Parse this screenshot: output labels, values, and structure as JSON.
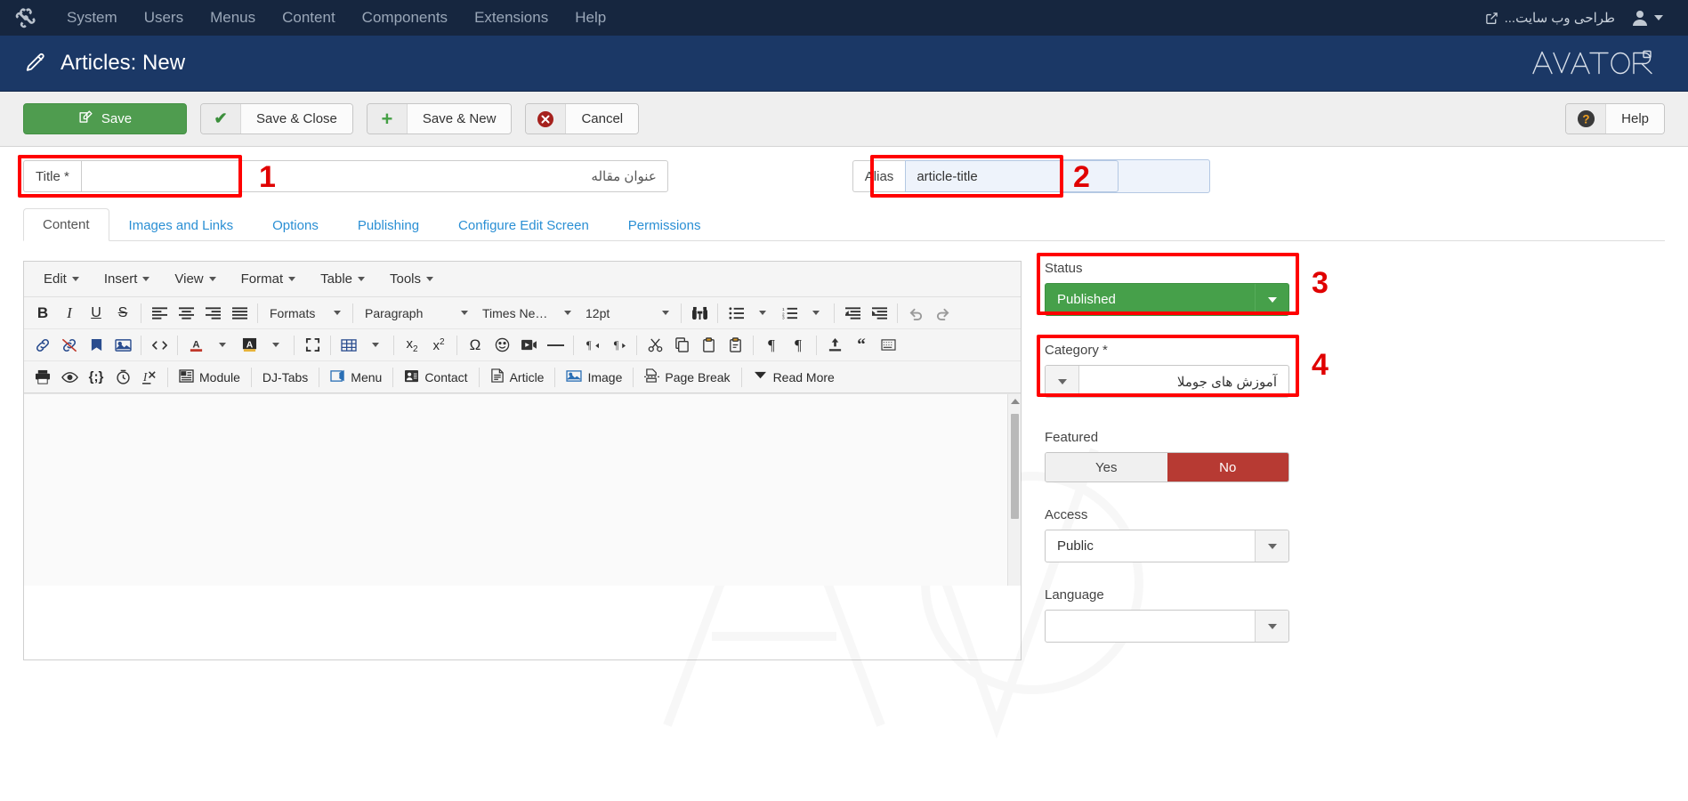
{
  "topnav": {
    "logo_icon": "joomla-logo-icon",
    "items": [
      "System",
      "Users",
      "Menus",
      "Content",
      "Components",
      "Extensions",
      "Help"
    ],
    "site_name": "طراحی وب سایت...",
    "external_link_icon": "external-link-icon",
    "user_icon": "user-avatar-icon"
  },
  "header": {
    "icon": "pencil-icon",
    "title": "Articles: New",
    "brand_logo": "AVATAR"
  },
  "toolbar": {
    "save_label": "Save",
    "save_icon": "save-pencil-icon",
    "save_close_label": "Save & Close",
    "save_close_icon": "check-icon",
    "save_new_label": "Save & New",
    "save_new_icon": "plus-icon",
    "cancel_label": "Cancel",
    "cancel_icon": "cancel-circle-icon",
    "help_label": "Help",
    "help_icon": "question-circle-icon"
  },
  "form": {
    "title_label": "Title *",
    "title_value": "عنوان مقاله",
    "alias_label": "Alias",
    "alias_value": "article-title",
    "annotations": [
      "1",
      "2",
      "3",
      "4"
    ]
  },
  "tabs": [
    {
      "label": "Content",
      "active": true
    },
    {
      "label": "Images and Links",
      "active": false
    },
    {
      "label": "Options",
      "active": false
    },
    {
      "label": "Publishing",
      "active": false
    },
    {
      "label": "Configure Edit Screen",
      "active": false
    },
    {
      "label": "Permissions",
      "active": false
    }
  ],
  "editor": {
    "menubar": [
      "Edit",
      "Insert",
      "View",
      "Format",
      "Table",
      "Tools"
    ],
    "row1": {
      "bold": "B",
      "italic": "I",
      "underline": "U",
      "strike": "S",
      "align_left": "align-left-icon",
      "align_center": "align-center-icon",
      "align_right": "align-right-icon",
      "align_justify": "align-justify-icon",
      "formats_label": "Formats",
      "paragraph_label": "Paragraph",
      "font_label": "Times Ne…",
      "fontsize_label": "12pt",
      "searchreplace": "binoculars-icon",
      "bullist": "bullet-list-icon",
      "numlist": "numbered-list-icon",
      "outdent": "outdent-icon",
      "indent": "indent-icon",
      "undo": "undo-icon",
      "redo": "redo-icon"
    },
    "row2": {
      "link": "link-icon",
      "unlink": "unlink-icon",
      "anchor": "anchor-icon",
      "image": "image-icon",
      "code": "source-code-icon",
      "forecolor": "text-color-icon",
      "backcolor": "highlight-color-icon",
      "fullscreen": "fullscreen-icon",
      "table": "table-icon",
      "subscript": "subscript-icon",
      "superscript": "superscript-icon",
      "charmap": "omega-special-char-icon",
      "emoticons": "emoticon-icon",
      "media": "media-icon",
      "hr": "horizontal-rule-icon",
      "ltr": "ltr-direction-icon",
      "rtl": "rtl-direction-icon",
      "cut": "cut-scissors-icon",
      "copy": "copy-icon",
      "paste": "paste-icon",
      "pastetext": "paste-text-icon",
      "visualchars": "pilcrow-icon",
      "visualblocks": "paragraph-blocks-icon",
      "template": "upload-template-icon",
      "blockquote": "blockquote-icon",
      "nonbreaking": "nonbreaking-space-icon"
    },
    "row3": [
      {
        "icon": "print-icon",
        "label": ""
      },
      {
        "icon": "preview-icon",
        "label": ""
      },
      {
        "icon": "code-braces-icon",
        "label": ""
      },
      {
        "icon": "insertdatetime-icon",
        "label": ""
      },
      {
        "icon": "remove-format-icon",
        "label": ""
      },
      {
        "icon": "module-icon",
        "label": "Module"
      },
      {
        "icon": "djtabs-icon",
        "label": "DJ-Tabs"
      },
      {
        "icon": "menu-icon",
        "label": "Menu"
      },
      {
        "icon": "contact-icon",
        "label": "Contact"
      },
      {
        "icon": "article-icon",
        "label": "Article"
      },
      {
        "icon": "image-icon",
        "label": "Image"
      },
      {
        "icon": "page-break-icon",
        "label": "Page Break"
      },
      {
        "icon": "read-more-icon",
        "label": "Read More"
      }
    ],
    "content": ""
  },
  "sidebar": {
    "status_label": "Status",
    "status_value": "Published",
    "category_label": "Category *",
    "category_value": "آموزش های جوملا",
    "featured_label": "Featured",
    "featured_yes": "Yes",
    "featured_no": "No",
    "access_label": "Access",
    "access_value": "Public",
    "language_label": "Language"
  },
  "colors": {
    "topnav_bg": "#16263f",
    "header_bg": "#1b3866",
    "save_green": "#4f9c4f",
    "status_green": "#46a04a",
    "featured_no_red": "#b73a33",
    "annotation_red": "#ff0000",
    "link_blue": "#2a8fd4"
  }
}
